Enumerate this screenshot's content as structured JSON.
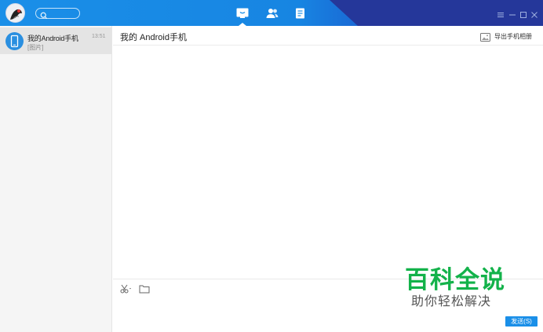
{
  "titlebar": {
    "search_placeholder": "",
    "tabs": [
      {
        "icon": "chat-icon",
        "active": true
      },
      {
        "icon": "contacts-icon",
        "active": false
      },
      {
        "icon": "notes-icon",
        "active": false
      }
    ],
    "window_controls": [
      "menu-icon",
      "minimize-icon",
      "maximize-icon",
      "close-icon"
    ],
    "accent_color": "#1a8fe8",
    "dark_color": "#25379a"
  },
  "sidebar": {
    "conversations": [
      {
        "name": "我的Android手机",
        "preview": "[图片]",
        "time": "13:51",
        "icon": "phone-icon"
      }
    ]
  },
  "chat": {
    "title": "我的 Android手机",
    "export_label": "导出手机相册"
  },
  "compose": {
    "tools": [
      "scissors-icon",
      "folder-icon"
    ],
    "send_label": "发送(S)"
  },
  "watermark": {
    "title": "百科全说",
    "subtitle": "助你轻松解决",
    "color": "#13b24a"
  }
}
